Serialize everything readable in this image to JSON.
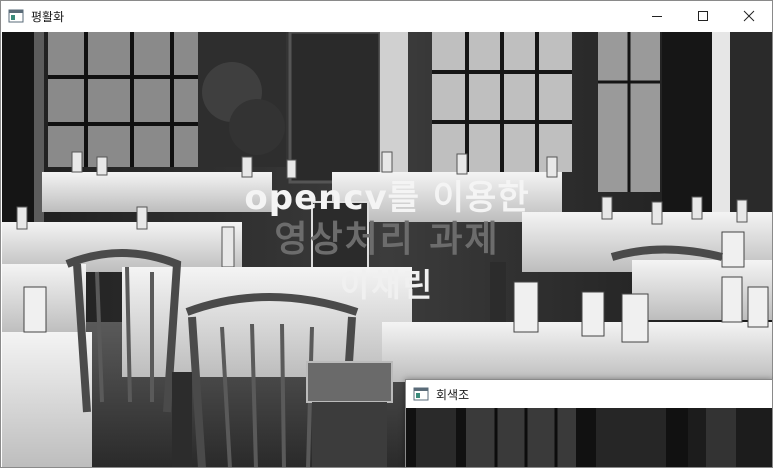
{
  "main_window": {
    "title": "평활화",
    "app_icon": "opencv-window-icon",
    "controls": [
      "minimize-icon",
      "maximize-icon",
      "close-icon"
    ],
    "overlay_text": {
      "line1": "opencv를 이용한",
      "line2": "영상처리 과제",
      "line3": "이채린"
    },
    "image_style": "grayscale"
  },
  "second_window": {
    "title": "회색조",
    "app_icon": "opencv-window-icon"
  }
}
